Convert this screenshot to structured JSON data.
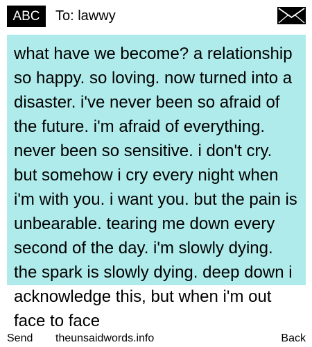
{
  "header": {
    "mode_label": "ABC",
    "to_label": "To: lawwy",
    "envelope_icon": "envelope-icon"
  },
  "message": {
    "text": "what have we become? a relationship so happy. so loving. now turned into a disaster. i've never been so afraid of the future. i'm afraid of everything. never been so sensitive. i don't cry. but somehow i cry every night when i'm with you. i want you. but the pain is unbearable. tearing me down every second of the day. i'm slowly dying. the spark is slowly dying. deep down i acknowledge this, but when i'm out face to face"
  },
  "footer": {
    "send_label": "Send",
    "site_label": "theunsaidwords.info",
    "back_label": "Back"
  },
  "colors": {
    "message_bg": "#afebeb",
    "badge_bg": "#000000"
  }
}
